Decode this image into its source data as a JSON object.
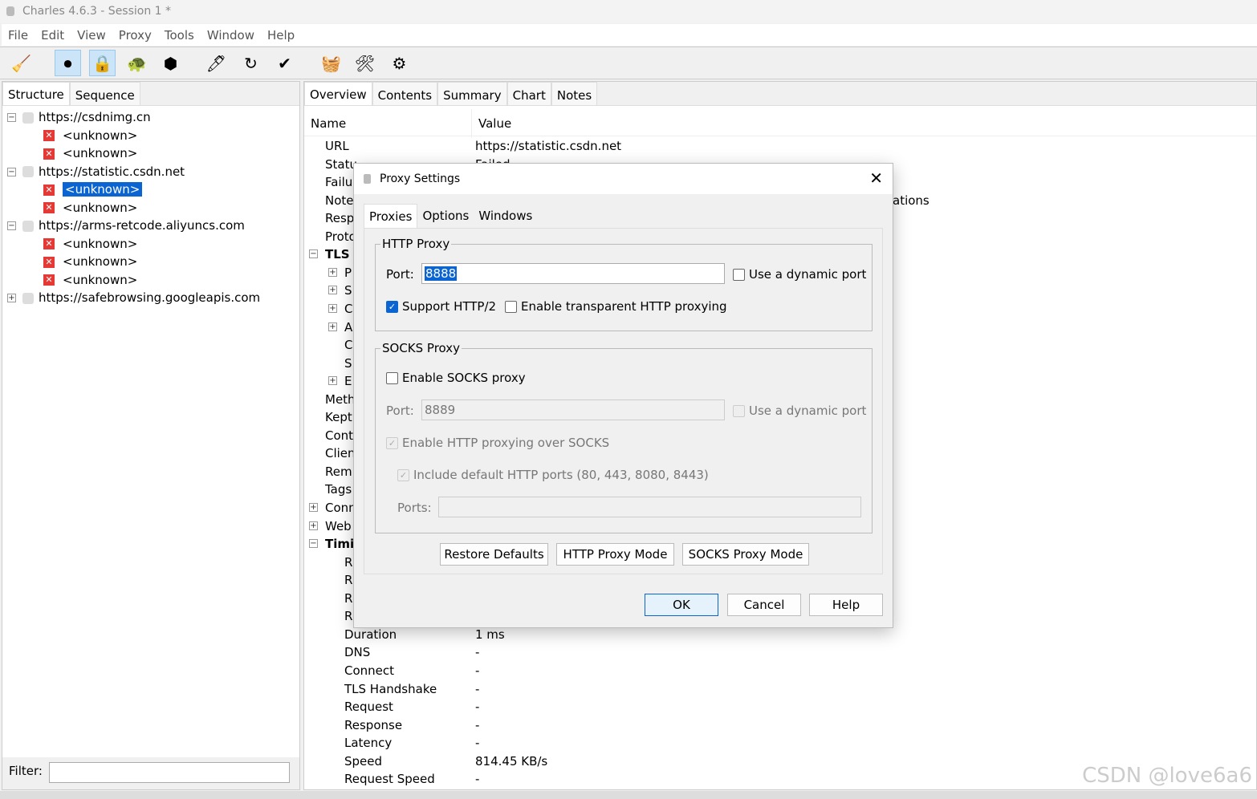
{
  "window": {
    "title": "Charles 4.6.3 - Session 1 *"
  },
  "menu": [
    "File",
    "Edit",
    "View",
    "Proxy",
    "Tools",
    "Window",
    "Help"
  ],
  "toolbar": [
    {
      "icon": "broom-icon",
      "glyph": "🧹",
      "active": false
    },
    {
      "icon": "record-icon",
      "glyph": "⏺",
      "active": true
    },
    {
      "icon": "ssl-lock-icon",
      "glyph": "🔒",
      "active": true
    },
    {
      "icon": "turtle-throttle-icon",
      "glyph": "🐢",
      "active": false
    },
    {
      "icon": "stop-breakpoint-icon",
      "glyph": "⬢",
      "active": false
    },
    {
      "icon": "pen-compose-icon",
      "glyph": "🖊",
      "active": false
    },
    {
      "icon": "refresh-repeat-icon",
      "glyph": "↻",
      "active": false
    },
    {
      "icon": "check-validate-icon",
      "glyph": "✔",
      "active": false
    },
    {
      "icon": "basket-icon",
      "glyph": "🧺",
      "active": false
    },
    {
      "icon": "tools-icon",
      "glyph": "🛠",
      "active": false
    },
    {
      "icon": "settings-gear-icon",
      "glyph": "⚙",
      "active": false
    }
  ],
  "left": {
    "tabs": [
      "Structure",
      "Sequence"
    ],
    "tree": [
      {
        "type": "host",
        "label": "https://csdnimg.cn",
        "expanded": true
      },
      {
        "type": "req",
        "label": "<unknown>"
      },
      {
        "type": "req",
        "label": "<unknown>"
      },
      {
        "type": "host",
        "label": "https://statistic.csdn.net",
        "expanded": true
      },
      {
        "type": "req",
        "label": "<unknown>",
        "selected": true
      },
      {
        "type": "req",
        "label": "<unknown>"
      },
      {
        "type": "host",
        "label": "https://arms-retcode.aliyuncs.com",
        "expanded": true
      },
      {
        "type": "req",
        "label": "<unknown>"
      },
      {
        "type": "req",
        "label": "<unknown>"
      },
      {
        "type": "req",
        "label": "<unknown>"
      },
      {
        "type": "host",
        "label": "https://safebrowsing.googleapis.com",
        "expanded": false
      }
    ],
    "filter_label": "Filter:",
    "filter_value": ""
  },
  "right": {
    "tabs": [
      "Overview",
      "Contents",
      "Summary",
      "Chart",
      "Notes"
    ],
    "columns": [
      "Name",
      "Value"
    ],
    "rows": [
      {
        "n": "URL",
        "v": "https://statistic.csdn.net",
        "lvl": 1
      },
      {
        "n": "Statu",
        "v": "Failed",
        "lvl": 1
      },
      {
        "n": "Failu",
        "v": "",
        "lvl": 1
      },
      {
        "n": "Note",
        "v": "ations",
        "lvl": 1
      },
      {
        "n": "Resp",
        "v": "",
        "lvl": 1
      },
      {
        "n": "Proto",
        "v": "",
        "lvl": 1
      },
      {
        "n": "TLS",
        "v": "",
        "lvl": 0,
        "bold": true,
        "pm": "−"
      },
      {
        "n": "P",
        "v": "",
        "lvl": 2,
        "pm": "+"
      },
      {
        "n": "S",
        "v": "",
        "lvl": 2,
        "pm": "+"
      },
      {
        "n": "C",
        "v": "",
        "lvl": 2,
        "pm": "+"
      },
      {
        "n": "A",
        "v": "",
        "lvl": 2,
        "pm": "+"
      },
      {
        "n": "C",
        "v": "",
        "lvl": 2
      },
      {
        "n": "S",
        "v": "",
        "lvl": 2
      },
      {
        "n": "E",
        "v": "",
        "lvl": 2,
        "pm": "+"
      },
      {
        "n": "Meth",
        "v": "",
        "lvl": 1
      },
      {
        "n": "Kept",
        "v": "",
        "lvl": 1
      },
      {
        "n": "Cont",
        "v": "",
        "lvl": 1
      },
      {
        "n": "Clien",
        "v": "",
        "lvl": 1
      },
      {
        "n": "Rem",
        "v": "",
        "lvl": 1
      },
      {
        "n": "Tags",
        "v": "",
        "lvl": 1
      },
      {
        "n": "Conn",
        "v": "",
        "lvl": 0,
        "pm": "+"
      },
      {
        "n": "Web",
        "v": "",
        "lvl": 0,
        "pm": "+"
      },
      {
        "n": "Timi",
        "v": "",
        "lvl": 0,
        "bold": true,
        "pm": "−"
      },
      {
        "n": "R",
        "v": "",
        "lvl": 2
      },
      {
        "n": "R",
        "v": "",
        "lvl": 2
      },
      {
        "n": "R",
        "v": "",
        "lvl": 2
      },
      {
        "n": "R",
        "v": "",
        "lvl": 2
      },
      {
        "n": "Duration",
        "v": "1 ms",
        "lvl": 2
      },
      {
        "n": "DNS",
        "v": "-",
        "lvl": 2
      },
      {
        "n": "Connect",
        "v": "-",
        "lvl": 2
      },
      {
        "n": "TLS Handshake",
        "v": "-",
        "lvl": 2
      },
      {
        "n": "Request",
        "v": "-",
        "lvl": 2
      },
      {
        "n": "Response",
        "v": "-",
        "lvl": 2
      },
      {
        "n": "Latency",
        "v": "-",
        "lvl": 2
      },
      {
        "n": "Speed",
        "v": "814.45 KB/s",
        "lvl": 2
      },
      {
        "n": "Request Speed",
        "v": "-",
        "lvl": 2
      }
    ]
  },
  "dialog": {
    "title": "Proxy Settings",
    "tabs": [
      "Proxies",
      "Options",
      "Windows"
    ],
    "http": {
      "legend": "HTTP Proxy",
      "port_label": "Port:",
      "port": "8888",
      "dynamic": "Use a dynamic port",
      "http2": "Support HTTP/2",
      "transparent": "Enable transparent HTTP proxying"
    },
    "socks": {
      "legend": "SOCKS Proxy",
      "enable": "Enable SOCKS proxy",
      "port_label": "Port:",
      "port": "8889",
      "dynamic": "Use a dynamic port",
      "over_socks": "Enable HTTP proxying over SOCKS",
      "include_default": "Include default HTTP ports (80, 443, 8080, 8443)",
      "ports_label": "Ports:",
      "ports": ""
    },
    "buttons": {
      "restore": "Restore Defaults",
      "http_mode": "HTTP Proxy Mode",
      "socks_mode": "SOCKS Proxy Mode",
      "ok": "OK",
      "cancel": "Cancel",
      "help": "Help"
    }
  },
  "watermark": "CSDN @love6a6"
}
